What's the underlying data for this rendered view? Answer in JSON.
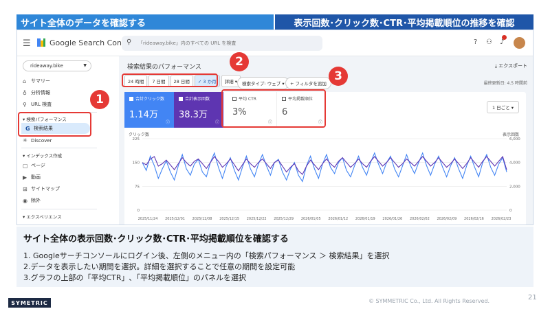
{
  "header": {
    "left_band": "サイト全体のデータを確認する",
    "right_band": "表示回数･クリック数･CTR･平均掲載順位の推移を確認"
  },
  "gsc": {
    "product_name": "Google Search Console",
    "search_placeholder": "「rideaway.bike」内のすべての URL を検査",
    "property": "rideaway.bike",
    "nav": {
      "summary": "サマリー",
      "insights": "分析情報",
      "url_inspection": "URL 検査",
      "performance_section": "検索パフォーマンス",
      "search_results": "検索結果",
      "discover": "Discover",
      "index_section": "インデックス作成",
      "pages": "ページ",
      "videos": "動画",
      "sitemaps": "サイトマップ",
      "removals": "除外",
      "experience_section": "エクスペリエンス"
    },
    "page_title": "検索結果のパフォーマンス",
    "export_label": "エクスポート",
    "date_chips": [
      "24 時間",
      "7 日間",
      "28 日間",
      "3 か月",
      "詳細"
    ],
    "selected_chip": "3 か月",
    "search_type": "検索タイプ: ウェブ",
    "add_filter": "フィルタを追加",
    "last_updated": "最終更新日: 4.5 時間前",
    "kpis": {
      "clicks_label": "合計クリック数",
      "clicks_value": "1.14万",
      "impressions_label": "合計表示回数",
      "impressions_value": "38.3万",
      "ctr_label": "平均 CTR",
      "ctr_value": "3%",
      "position_label": "平均掲載順位",
      "position_value": "6"
    },
    "granularity": "1 日ごと"
  },
  "chart_data": {
    "type": "line",
    "y_left_label": "クリック数",
    "y_right_label": "表示回数",
    "y_left_ticks": [
      "225",
      "150",
      "75",
      "0"
    ],
    "y_right_ticks": [
      "6,000",
      "4,000",
      "2,000",
      "0"
    ],
    "y_left_range": [
      0,
      225
    ],
    "y_right_range": [
      0,
      6000
    ],
    "x_ticks": [
      "2025/11/24",
      "2025/12/01",
      "2025/12/08",
      "2025/12/15",
      "2025/12/22",
      "2025/12/29",
      "2026/01/05",
      "2026/01/12",
      "2026/01/19",
      "2026/01/26",
      "2026/02/02",
      "2026/02/09",
      "2026/02/16",
      "2026/02/23"
    ],
    "series": [
      {
        "name": "クリック数",
        "color": "#4285f4",
        "values": [
          150,
          125,
          170,
          140,
          100,
          130,
          155,
          120,
          95,
          140,
          175,
          130,
          110,
          145,
          160,
          120,
          105,
          150,
          180,
          135,
          100,
          140,
          165,
          125,
          95,
          135,
          170,
          130,
          105,
          145,
          175,
          140,
          110,
          150,
          160,
          120,
          95,
          130,
          150,
          110,
          90,
          140,
          170,
          130,
          100,
          145,
          175,
          135,
          115,
          150,
          165,
          125,
          105,
          140,
          170,
          135,
          110,
          150,
          180,
          145,
          115,
          150,
          170,
          130,
          105,
          140,
          175,
          140,
          115,
          150,
          180,
          140,
          110,
          145,
          170,
          135,
          105,
          140,
          165,
          130,
          100,
          140,
          170,
          135,
          105,
          150,
          175,
          135,
          110,
          145,
          165,
          120
        ]
      },
      {
        "name": "表示回数",
        "color": "#5e35b1",
        "values": [
          4000,
          3800,
          4300,
          4500,
          3700,
          3900,
          4200,
          3800,
          3400,
          3900,
          4400,
          4000,
          3700,
          4100,
          4300,
          3900,
          3500,
          4000,
          4500,
          4100,
          3600,
          3900,
          4300,
          3800,
          3300,
          3800,
          4300,
          3900,
          3600,
          4000,
          4300,
          3900,
          3500,
          4000,
          4200,
          3700,
          3200,
          3600,
          3900,
          3300,
          3000,
          3700,
          4200,
          3800,
          3400,
          3900,
          4300,
          3900,
          3600,
          4100,
          4400,
          4000,
          3600,
          3900,
          4300,
          3900,
          3600,
          4100,
          4500,
          4100,
          3700,
          4000,
          4400,
          4000,
          3600,
          3900,
          4300,
          4000,
          3700,
          4100,
          4500,
          4100,
          3700,
          4000,
          4400,
          4000,
          3600,
          3900,
          4300,
          3900,
          3500,
          3900,
          4400,
          4000,
          3600,
          4100,
          4500,
          4100,
          3700,
          4100,
          4500,
          3400
        ]
      }
    ]
  },
  "badges": [
    "1",
    "2",
    "3"
  ],
  "caption": {
    "title": "サイト全体の表示回数･クリック数･CTR･平均掲載順位を確認する",
    "step1": "1. Googleサーチコンソールにログイン後、左側のメニュー内の「検索パフォーマンス ＞ 検索結果」を選択",
    "step2": "2.データを表示したい期間を選択。詳細を選択することで任意の期間を設定可能",
    "step3": "3.グラフの上部の「平均CTR」､「平均掲載順位」のパネルを選択"
  },
  "footer": {
    "logo": "SYMETRIC",
    "copyright": "© SYMMETRIC Co., Ltd. All Rights Reserved.",
    "page_number": "21"
  }
}
